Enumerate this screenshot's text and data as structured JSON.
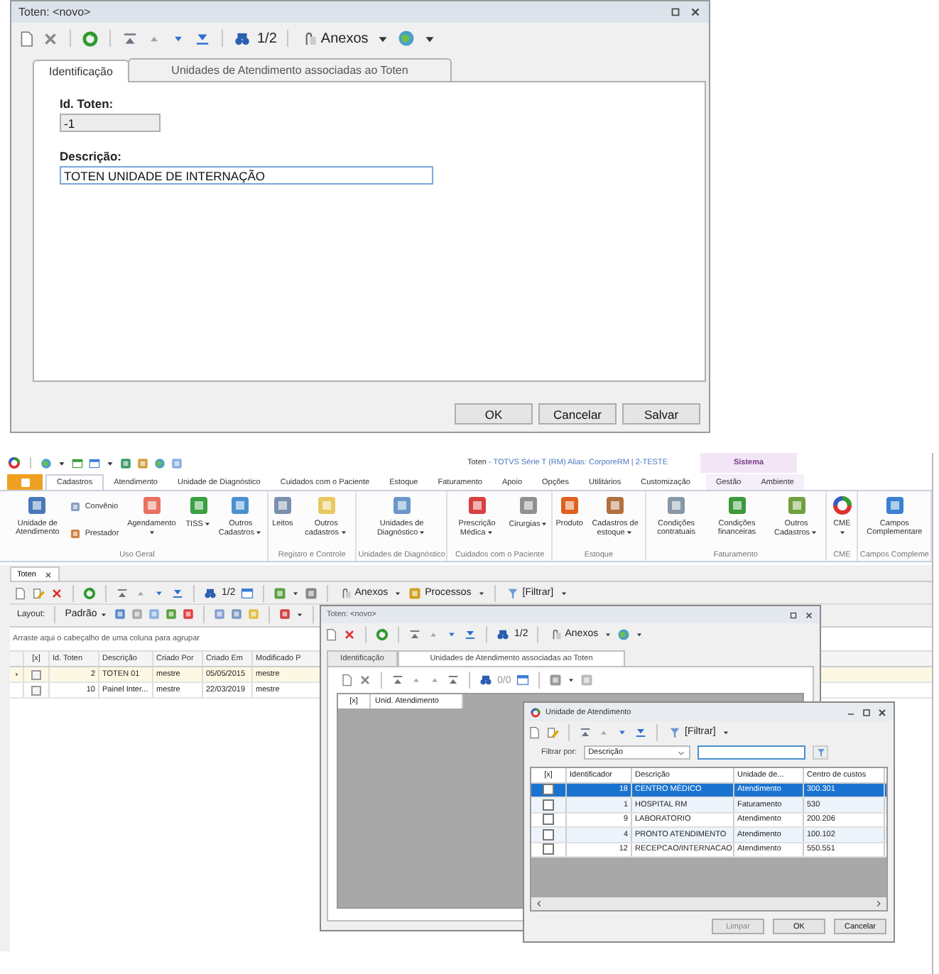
{
  "dialog": {
    "title": "Toten: <novo>",
    "counter": "1/2",
    "attachments": "Anexos",
    "tabs": [
      {
        "label": "Identificação",
        "selected": true
      },
      {
        "label": "Unidades de Atendimento associadas ao Toten",
        "selected": false
      }
    ],
    "fields": [
      {
        "label": "Id. Toten:",
        "value": "-1",
        "disabled": true
      },
      {
        "label": "Descrição:",
        "value": "TOTEN UNIDADE DE INTERNAÇÃO",
        "disabled": false
      }
    ],
    "buttons": [
      "OK",
      "Cancelar",
      "Salvar"
    ]
  },
  "app": {
    "title": "Toten",
    "subtitle": "- TOTVS Série T  (RM) Alias: CorporeRM | 2-TESTE",
    "context_group": "Sistema",
    "menu_tabs": [
      {
        "label": "Cadastros",
        "selected": true,
        "contextual": false
      },
      {
        "label": "Atendimento",
        "selected": false,
        "contextual": false
      },
      {
        "label": "Unidade de Diagnóstico",
        "selected": false,
        "contextual": false
      },
      {
        "label": "Cuidados com o Paciente",
        "selected": false,
        "contextual": false
      },
      {
        "label": "Estoque",
        "selected": false,
        "contextual": false
      },
      {
        "label": "Faturamento",
        "selected": false,
        "contextual": false
      },
      {
        "label": "Apoio",
        "selected": false,
        "contextual": false
      },
      {
        "label": "Opções",
        "selected": false,
        "contextual": false
      },
      {
        "label": "Utilitários",
        "selected": false,
        "contextual": false
      },
      {
        "label": "Customização",
        "selected": false,
        "contextual": false
      },
      {
        "label": "Gestão",
        "selected": false,
        "contextual": true
      },
      {
        "label": "Ambiente",
        "selected": false,
        "contextual": true
      }
    ],
    "ribbon_groups": [
      {
        "label": "Uso Geral",
        "items": [
          {
            "label": "Unidade de Atendimento",
            "kind": "large",
            "dropdown": false
          },
          {
            "label": "Convênio",
            "kind": "small",
            "dropdown": false
          },
          {
            "label": "Prestador",
            "kind": "small",
            "dropdown": false
          },
          {
            "label": "Agendamento",
            "kind": "large",
            "dropdown": true
          },
          {
            "label": "TISS",
            "kind": "large",
            "dropdown": true
          },
          {
            "label": "Outros Cadastros",
            "kind": "large",
            "dropdown": true
          }
        ]
      },
      {
        "label": "Registro e Controle",
        "items": [
          {
            "label": "Leitos",
            "kind": "large",
            "dropdown": false
          },
          {
            "label": "Outros cadastros",
            "kind": "large",
            "dropdown": true
          }
        ]
      },
      {
        "label": "Unidades de Diagnóstico",
        "items": [
          {
            "label": "Unidades de Diagnóstico",
            "kind": "large",
            "dropdown": true
          }
        ]
      },
      {
        "label": "Cuidados com o Paciente",
        "items": [
          {
            "label": "Prescrição Médica",
            "kind": "large",
            "dropdown": true
          },
          {
            "label": "Cirurgias",
            "kind": "large",
            "dropdown": true
          }
        ]
      },
      {
        "label": "Estoque",
        "items": [
          {
            "label": "Produto",
            "kind": "large",
            "dropdown": false
          },
          {
            "label": "Cadastros de estoque",
            "kind": "large",
            "dropdown": true
          }
        ]
      },
      {
        "label": "Faturamento",
        "items": [
          {
            "label": "Condições contratuais",
            "kind": "large",
            "dropdown": false
          },
          {
            "label": "Condições financeiras",
            "kind": "large",
            "dropdown": false
          },
          {
            "label": "Outros Cadastros",
            "kind": "large",
            "dropdown": true
          }
        ]
      },
      {
        "label": "CME",
        "items": [
          {
            "label": "CME",
            "kind": "large",
            "dropdown": true
          }
        ]
      },
      {
        "label": "Campos Compleme",
        "items": [
          {
            "label": "Campos Complementare",
            "kind": "large",
            "dropdown": false
          }
        ]
      }
    ],
    "document_tab": "Toten",
    "counter": "1/2",
    "attachments": "Anexos",
    "processes": "Processos",
    "filter": "[Filtrar]",
    "layout_label": "Layout:",
    "layout_value": "Padrão",
    "group_hint": "Arraste aqui o cabeçalho de uma coluna para agrupar",
    "checkbox_header": "[x]",
    "columns": [
      "Id. Toten",
      "Descrição",
      "Criado Por",
      "Criado Em",
      "Modificado P"
    ],
    "rows": [
      {
        "selected": true,
        "checked": false,
        "cells": [
          "2",
          "TOTEN 01",
          "mestre",
          "05/05/2015",
          "mestre"
        ]
      },
      {
        "selected": false,
        "checked": false,
        "cells": [
          "10",
          "Painel Inter...",
          "mestre",
          "22/03/2019",
          "mestre"
        ]
      }
    ]
  },
  "toten_window": {
    "title": "Toten: <novo>",
    "counter": "1/2",
    "attachments": "Anexos",
    "tabs": [
      {
        "label": "Identificação",
        "selected": false
      },
      {
        "label": "Unidades de Atendimento associadas ao Toten",
        "selected": true
      }
    ],
    "sub_counter": "0/0",
    "columns": [
      "[x]",
      "Unid. Atendimento"
    ]
  },
  "lookup": {
    "title": "Unidade de Atendimento",
    "filter": "[Filtrar]",
    "filter_label": "Filtrar por:",
    "filter_field": "Descrição",
    "checkbox_header": "[x]",
    "columns": [
      "Identificador",
      "Descrição",
      "Unidade de...",
      "Centro de custos"
    ],
    "rows": [
      {
        "selected": true,
        "checked": false,
        "cells": [
          "18",
          "CENTRO MÉDICO",
          "Atendimento",
          "300.301"
        ]
      },
      {
        "selected": false,
        "checked": false,
        "cells": [
          "1",
          "HOSPITAL RM",
          "Faturamento",
          "530"
        ]
      },
      {
        "selected": false,
        "checked": false,
        "cells": [
          "9",
          "LABORATORIO",
          "Atendimento",
          "200.206"
        ]
      },
      {
        "selected": false,
        "checked": false,
        "cells": [
          "4",
          "PRONTO ATENDIMENTO",
          "Atendimento",
          "100.102"
        ]
      },
      {
        "selected": false,
        "checked": false,
        "cells": [
          "12",
          "RECEPCAO/INTERNACAO",
          "Atendimento",
          "550.551"
        ]
      }
    ],
    "buttons": [
      {
        "label": "Limpar",
        "disabled": true
      },
      {
        "label": "OK",
        "disabled": false
      },
      {
        "label": "Cancelar",
        "disabled": false
      }
    ]
  }
}
